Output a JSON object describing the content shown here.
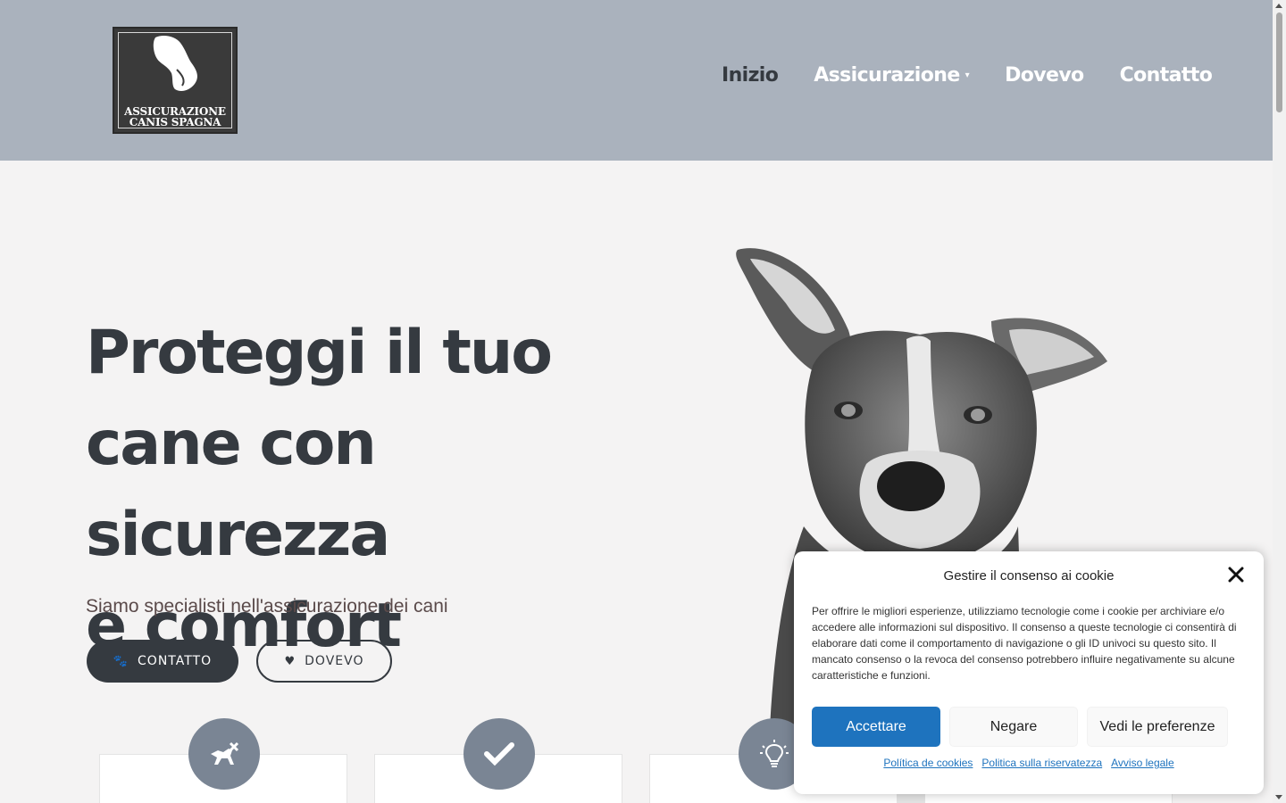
{
  "header": {
    "logo_text_line1": "ASSICURAZIONE",
    "logo_text_line2": "CANIS SPAGNA",
    "nav": [
      {
        "label": "Inizio"
      },
      {
        "label": "Assicurazione"
      },
      {
        "label": "Dovevo"
      },
      {
        "label": "Contatto"
      }
    ]
  },
  "hero": {
    "title_line1": "Proteggi il tuo",
    "title_line2": "cane con sicurezza",
    "title_line3": "e comfort",
    "subtitle": "Siamo specialisti nell'assicurazione dei cani",
    "btn_contact": "CONTATTO",
    "btn_dovevo": "DOVEVO"
  },
  "features": {
    "icons": [
      "dog-walk-icon",
      "check-icon",
      "lightbulb-icon"
    ]
  },
  "cookie": {
    "title": "Gestire il consenso ai cookie",
    "body": "Per offrire le migliori esperienze, utilizziamo tecnologie come i cookie per archiviare e/o accedere alle informazioni sul dispositivo. Il consenso a queste tecnologie ci consentirà di elaborare dati come il comportamento di navigazione o gli ID univoci su questo sito. Il mancato consenso o la revoca del consenso potrebbero influire negativamente su alcune caratteristiche e funzioni.",
    "accept": "Accettare",
    "deny": "Negare",
    "prefs": "Vedi le preferenze",
    "links": [
      "Política de cookies",
      "Politica sulla riservatezza",
      "Avviso legale"
    ]
  },
  "colors": {
    "header_bg": "#aab2bd",
    "page_bg": "#f4f3f3",
    "dark": "#353a40",
    "accent_blue": "#1e73be",
    "icon_circle": "#7a8594"
  }
}
